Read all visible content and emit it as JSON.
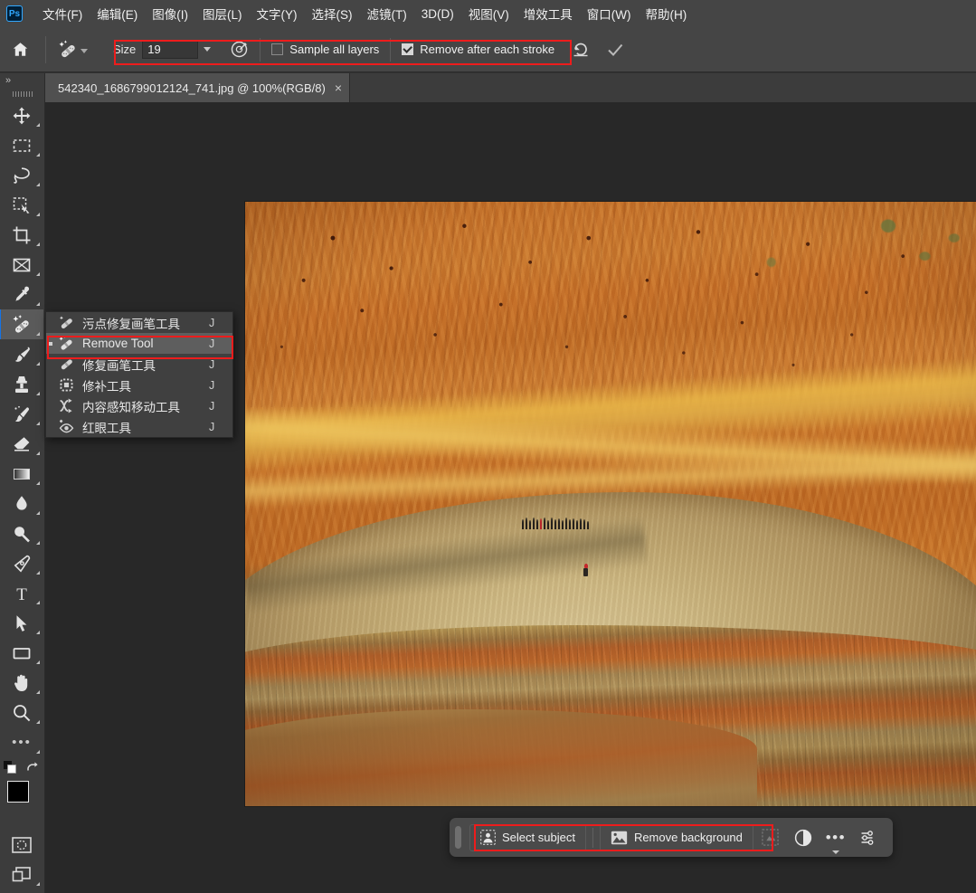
{
  "app": {
    "name": "Adobe Photoshop",
    "logo_text": "Ps"
  },
  "menubar": {
    "items": [
      {
        "label": "文件(F)",
        "name": "menu-file"
      },
      {
        "label": "编辑(E)",
        "name": "menu-edit"
      },
      {
        "label": "图像(I)",
        "name": "menu-image"
      },
      {
        "label": "图层(L)",
        "name": "menu-layer"
      },
      {
        "label": "文字(Y)",
        "name": "menu-type"
      },
      {
        "label": "选择(S)",
        "name": "menu-select"
      },
      {
        "label": "滤镜(T)",
        "name": "menu-filter"
      },
      {
        "label": "3D(D)",
        "name": "menu-3d"
      },
      {
        "label": "视图(V)",
        "name": "menu-view"
      },
      {
        "label": "增效工具",
        "name": "menu-plugins"
      },
      {
        "label": "窗口(W)",
        "name": "menu-window"
      },
      {
        "label": "帮助(H)",
        "name": "menu-help"
      }
    ]
  },
  "options_bar": {
    "home_icon": "home-icon",
    "tool_preset_icon": "remove-tool-icon",
    "size_label": "Size",
    "size_value": "19",
    "size_dropdown_icon": "chevron-down-icon",
    "brush_settings_icon": "brush-settings-icon",
    "sample_all_layers_label": "Sample all layers",
    "sample_all_layers_checked": false,
    "remove_after_each_stroke_label": "Remove after each stroke",
    "remove_after_each_stroke_checked": true,
    "reset_icon": "undo-reset-icon",
    "commit_icon": "checkmark-icon"
  },
  "tab": {
    "title": "542340_1686799012124_741.jpg @ 100%(RGB/8)",
    "close_icon": "×"
  },
  "toolbar": {
    "expand_icon": "»",
    "grip_icon": "drag-grip-icon",
    "tools": [
      {
        "name": "move-tool",
        "icon": "move-icon"
      },
      {
        "name": "rectangular-marquee-tool",
        "icon": "marquee-icon"
      },
      {
        "name": "lasso-tool",
        "icon": "lasso-icon"
      },
      {
        "name": "quick-selection-tool",
        "icon": "quick-select-icon"
      },
      {
        "name": "crop-tool",
        "icon": "crop-icon"
      },
      {
        "name": "frame-tool",
        "icon": "frame-icon"
      },
      {
        "name": "eyedropper-tool",
        "icon": "eyedropper-icon"
      },
      {
        "name": "remove-tool",
        "icon": "remove-tool-icon",
        "selected": true
      },
      {
        "name": "brush-tool",
        "icon": "brush-icon"
      },
      {
        "name": "clone-stamp-tool",
        "icon": "clone-stamp-icon"
      },
      {
        "name": "history-brush-tool",
        "icon": "history-brush-icon"
      },
      {
        "name": "eraser-tool",
        "icon": "eraser-icon"
      },
      {
        "name": "gradient-tool",
        "icon": "gradient-icon"
      },
      {
        "name": "blur-tool",
        "icon": "blur-droplet-icon"
      },
      {
        "name": "dodge-tool",
        "icon": "dodge-icon"
      },
      {
        "name": "pen-tool",
        "icon": "pen-icon"
      },
      {
        "name": "type-tool",
        "icon": "type-t-icon"
      },
      {
        "name": "path-selection-tool",
        "icon": "path-arrow-icon"
      },
      {
        "name": "rectangle-tool",
        "icon": "rectangle-icon"
      },
      {
        "name": "hand-tool",
        "icon": "hand-icon"
      },
      {
        "name": "zoom-tool",
        "icon": "magnifier-icon"
      },
      {
        "name": "edit-toolbar-button",
        "icon": "ellipsis-icon"
      }
    ],
    "foreground_color": "#000000",
    "background_color": "#ffffff",
    "swap_colors_icon": "swap-colors-icon",
    "default_colors_icon": "default-colors-icon",
    "quick_mask_icon": "quick-mask-icon",
    "screen_mode_icon": "screen-mode-icon"
  },
  "tool_flyout": {
    "items": [
      {
        "label": "污点修复画笔工具",
        "shortcut": "J",
        "icon": "spot-healing-brush-icon",
        "active": false
      },
      {
        "label": "Remove Tool",
        "shortcut": "J",
        "icon": "remove-tool-icon",
        "active": true
      },
      {
        "label": "修复画笔工具",
        "shortcut": "J",
        "icon": "healing-brush-icon",
        "active": false
      },
      {
        "label": "修补工具",
        "shortcut": "J",
        "icon": "patch-tool-icon",
        "active": false
      },
      {
        "label": "内容感知移动工具",
        "shortcut": "J",
        "icon": "content-aware-move-icon",
        "active": false
      },
      {
        "label": "红眼工具",
        "shortcut": "J",
        "icon": "red-eye-icon",
        "active": false
      }
    ]
  },
  "task_bar": {
    "handle_icon": "drag-handle-icon",
    "select_subject_label": "Select subject",
    "select_subject_icon": "person-icon",
    "remove_background_label": "Remove background",
    "remove_background_icon": "image-icon",
    "transform_icon": "transform-icon",
    "adjustment_icon": "adjustment-circle-icon",
    "more_icon": "ellipsis-icon",
    "settings_icon": "sliders-icon"
  },
  "highlights": {
    "accent_color": "#ee1c1c",
    "boxes": [
      {
        "name": "options-bar-highlight"
      },
      {
        "name": "remove-tool-flyout-highlight"
      },
      {
        "name": "task-bar-buttons-highlight"
      }
    ]
  },
  "canvas": {
    "zoom": "100%",
    "color_mode": "RGB/8",
    "photo_description": "Zhangye Danxia rainbow mountains with tourists on ridge"
  }
}
